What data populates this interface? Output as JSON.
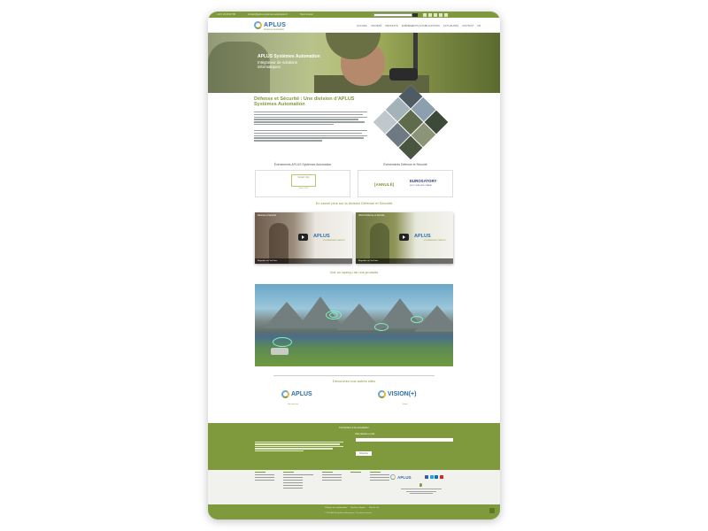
{
  "topbar": {
    "phone": "+33 1 23 45 67 89",
    "email": "contact@aplus-systemes-automation.fr",
    "location": "Nous trouver",
    "search_placeholder": "Rechercher"
  },
  "brand": {
    "name": "APLUS",
    "tagline": "Systèmes Automation"
  },
  "nav": {
    "items": [
      "ACCUEIL",
      "SOCIÉTÉ",
      "PRODUITS",
      "ÉVÉNEMENTS & PUBLICATIONS",
      "ACTUALITÉS",
      "CONTACT",
      "FR"
    ]
  },
  "hero": {
    "title": "APLUS Systèmes Automation",
    "subtitle": "Intégrateur de solutions informatiques"
  },
  "intro": {
    "heading": "Défense et Sécurité : Une division d'APLUS Systèmes Automation"
  },
  "events": {
    "left_title": "Événements APLUS Systèmes Automation",
    "right_title": "Événements Défense et Sécurité",
    "left_badge": "Smart City",
    "left_sub": "Salon 2020",
    "right_annule": "[ANNULÉ]",
    "right_logo": "EUROSATORY",
    "right_sub": "08-12 JUIN 2020 / PARIS"
  },
  "videos_section": {
    "title": "En savoir plus sur la division Défense et Sécurité",
    "videos": [
      {
        "title": "Défense et Sécurité",
        "logo": "APLUS",
        "logo_sub": "SYSTÈMES AUTOMATION",
        "bar": "Regarder sur YouTube"
      },
      {
        "title": "APLUS Défense et Sécurité",
        "logo": "APLUS",
        "logo_sub": "SYSTÈMES AUTOMATION",
        "bar": "Regarder sur YouTube"
      }
    ]
  },
  "products_section": {
    "title": "Voir un aperçu de nos produits"
  },
  "other_sites": {
    "title": "Découvrez nos autres sites",
    "sites": [
      {
        "name": "APLUS",
        "sub": "Site principal"
      },
      {
        "name": "VISION(+)",
        "sub": "Vision+"
      }
    ]
  },
  "newsletter": {
    "title": "Inscription à la newsletter",
    "email_label": "Votre adresse e-mail",
    "submit_label": "S'inscrire"
  },
  "footer": {
    "brand": "APLUS"
  },
  "bottombar": {
    "links": [
      "Politique de confidentialité",
      "Mentions légales",
      "Plan du site"
    ],
    "copyright": "© 2020 APLUS Systèmes Automation - Tous droits réservés"
  },
  "colors": {
    "accent_green": "#7e9a3d",
    "brand_blue": "#2f6ea8"
  }
}
